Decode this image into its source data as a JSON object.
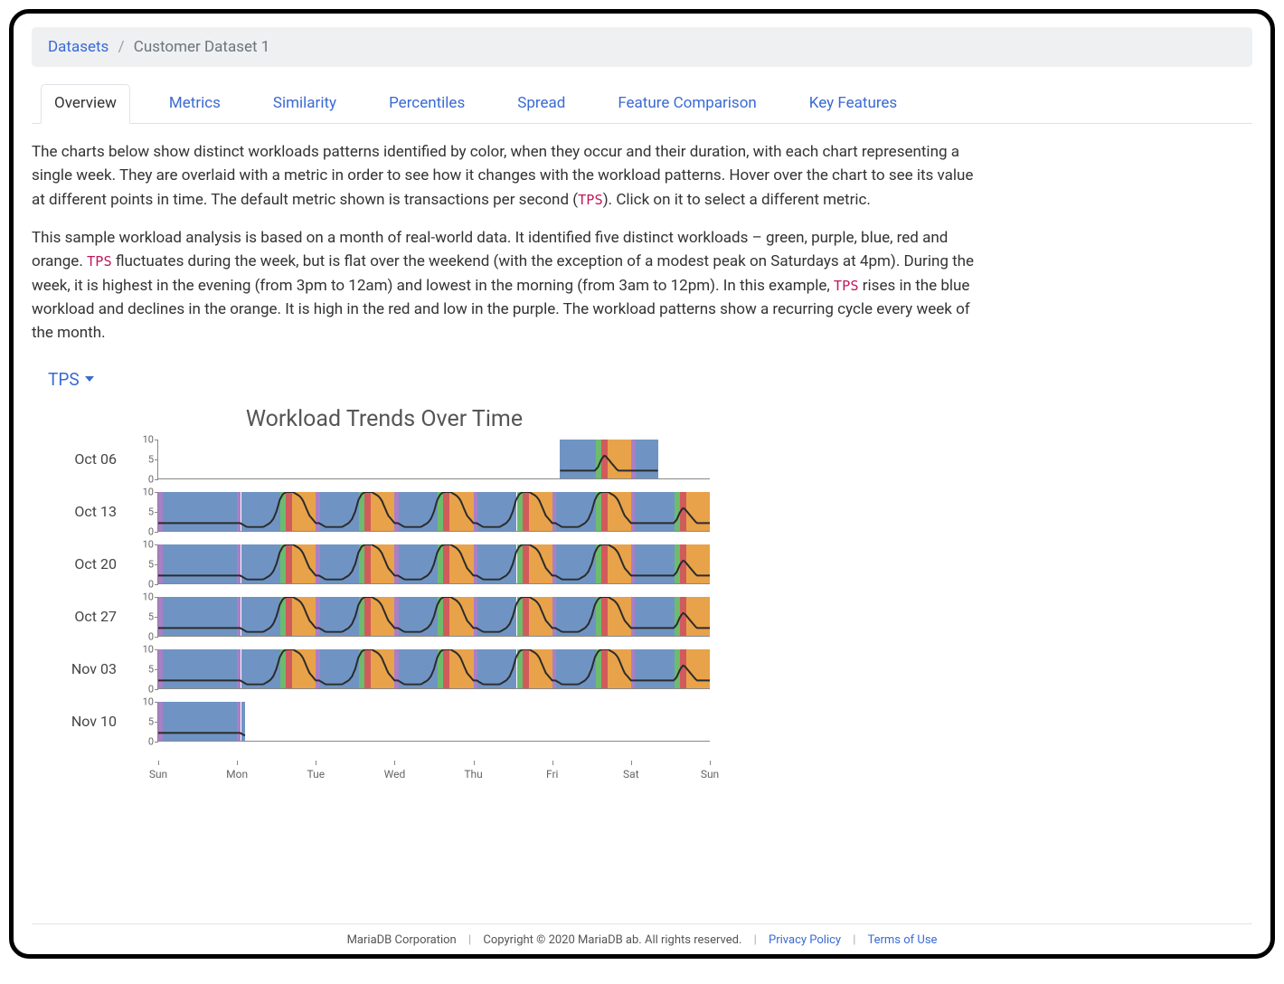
{
  "breadcrumb": {
    "root": "Datasets",
    "current": "Customer Dataset 1"
  },
  "tabs": [
    {
      "label": "Overview",
      "active": true
    },
    {
      "label": "Metrics"
    },
    {
      "label": "Similarity"
    },
    {
      "label": "Percentiles"
    },
    {
      "label": "Spread"
    },
    {
      "label": "Feature Comparison"
    },
    {
      "label": "Key Features"
    }
  ],
  "description": {
    "p1_a": "The charts below show distinct workloads patterns identified by color, when they occur and their duration, with each chart representing a single week. They are overlaid with a metric in order to see how it changes with the workload patterns. Hover over the chart to see its value at different points in time. The default metric shown is transactions per second (",
    "p1_tps": "TPS",
    "p1_b": "). Click on it to select a different metric.",
    "p2_a": "This sample workload analysis is based on a month of real-world data. It identified five distinct workloads – green, purple, blue, red and orange. ",
    "p2_tps1": "TPS",
    "p2_b": " fluctuates during the week, but is flat over the weekend (with the exception of a modest peak on Saturdays at 4pm). During the week, it is highest in the evening (from 3pm to 12am) and lowest in the morning (from 3am to 12pm). In this example, ",
    "p2_tps2": "TPS",
    "p2_c": " rises in the blue workload and declines in the orange. It is high in the red and low in the purple. The workload patterns show a recurring cycle every week of the month."
  },
  "metric_selector": {
    "label": "TPS"
  },
  "chart_title": "Workload Trends Over Time",
  "footer": {
    "company": "MariaDB Corporation",
    "copyright": "Copyright © 2020 MariaDB ab. All rights reserved.",
    "privacy": "Privacy Policy",
    "terms": "Terms of Use"
  },
  "chart_data": {
    "type": "line",
    "title": "Workload Trends Over Time",
    "ylabel": "TPS",
    "ylim": [
      0,
      10
    ],
    "yticks": [
      0,
      5,
      10
    ],
    "x_categories": [
      "Sun",
      "Mon",
      "Tue",
      "Wed",
      "Thu",
      "Fri",
      "Sat",
      "Sun"
    ],
    "workload_colors": {
      "green": "#6dbb6d",
      "purple": "#a97fc6",
      "blue": "#6f94c3",
      "red": "#d15b5b",
      "orange": "#e8a24a"
    },
    "day_pattern_segments": [
      {
        "color": "purple",
        "from": 0.0,
        "to": 0.05
      },
      {
        "color": "blue",
        "from": 0.05,
        "to": 0.55
      },
      {
        "color": "green",
        "from": 0.55,
        "to": 0.62
      },
      {
        "color": "red",
        "from": 0.62,
        "to": 0.7
      },
      {
        "color": "orange",
        "from": 0.7,
        "to": 1.0
      }
    ],
    "weekend_segments": [
      {
        "color": "purple",
        "from": 0.0,
        "to": 0.06
      },
      {
        "color": "blue",
        "from": 0.06,
        "to": 1.0
      }
    ],
    "weekday_tps_profile": [
      2,
      2,
      1.5,
      1,
      1,
      1,
      1,
      1,
      1,
      1.5,
      2,
      3,
      5,
      8,
      9.5,
      10,
      10,
      10,
      9.5,
      9,
      8,
      6,
      4,
      3
    ],
    "saturday_tps_profile": [
      2,
      2,
      2,
      2,
      2,
      2,
      2,
      2,
      2,
      2,
      2,
      2,
      2,
      2,
      3,
      5,
      6,
      5,
      4,
      3,
      2,
      2,
      2,
      2
    ],
    "weekend_tps_profile": [
      2,
      2,
      2,
      2,
      2,
      2,
      2,
      2,
      2,
      2,
      2,
      2,
      2,
      2,
      2,
      2,
      2,
      2,
      2,
      2,
      2,
      2,
      2,
      2
    ],
    "rows": [
      {
        "label": "Oct 06",
        "start_day": 5.1,
        "end_day": 6.35,
        "days": [
          "weekday",
          "weekday",
          "weekday",
          "weekday",
          "weekday",
          "saturday",
          "weekend"
        ]
      },
      {
        "label": "Oct 13",
        "start_day": 0,
        "end_day": 7,
        "days": [
          "weekend",
          "weekday",
          "weekday",
          "weekday",
          "weekday",
          "weekday",
          "saturday"
        ]
      },
      {
        "label": "Oct 20",
        "start_day": 0,
        "end_day": 7,
        "days": [
          "weekend",
          "weekday",
          "weekday",
          "weekday",
          "weekday",
          "weekday",
          "saturday"
        ]
      },
      {
        "label": "Oct 27",
        "start_day": 0,
        "end_day": 7,
        "days": [
          "weekend",
          "weekday",
          "weekday",
          "weekday",
          "weekday",
          "weekday",
          "saturday"
        ]
      },
      {
        "label": "Nov 03",
        "start_day": 0,
        "end_day": 7,
        "days": [
          "weekend",
          "weekday",
          "weekday",
          "weekday",
          "weekday",
          "weekday",
          "saturday"
        ]
      },
      {
        "label": "Nov 10",
        "start_day": 0,
        "end_day": 1.1,
        "days": [
          "weekend",
          "weekday",
          "weekday",
          "weekday",
          "weekday",
          "weekday",
          "saturday"
        ]
      }
    ]
  }
}
